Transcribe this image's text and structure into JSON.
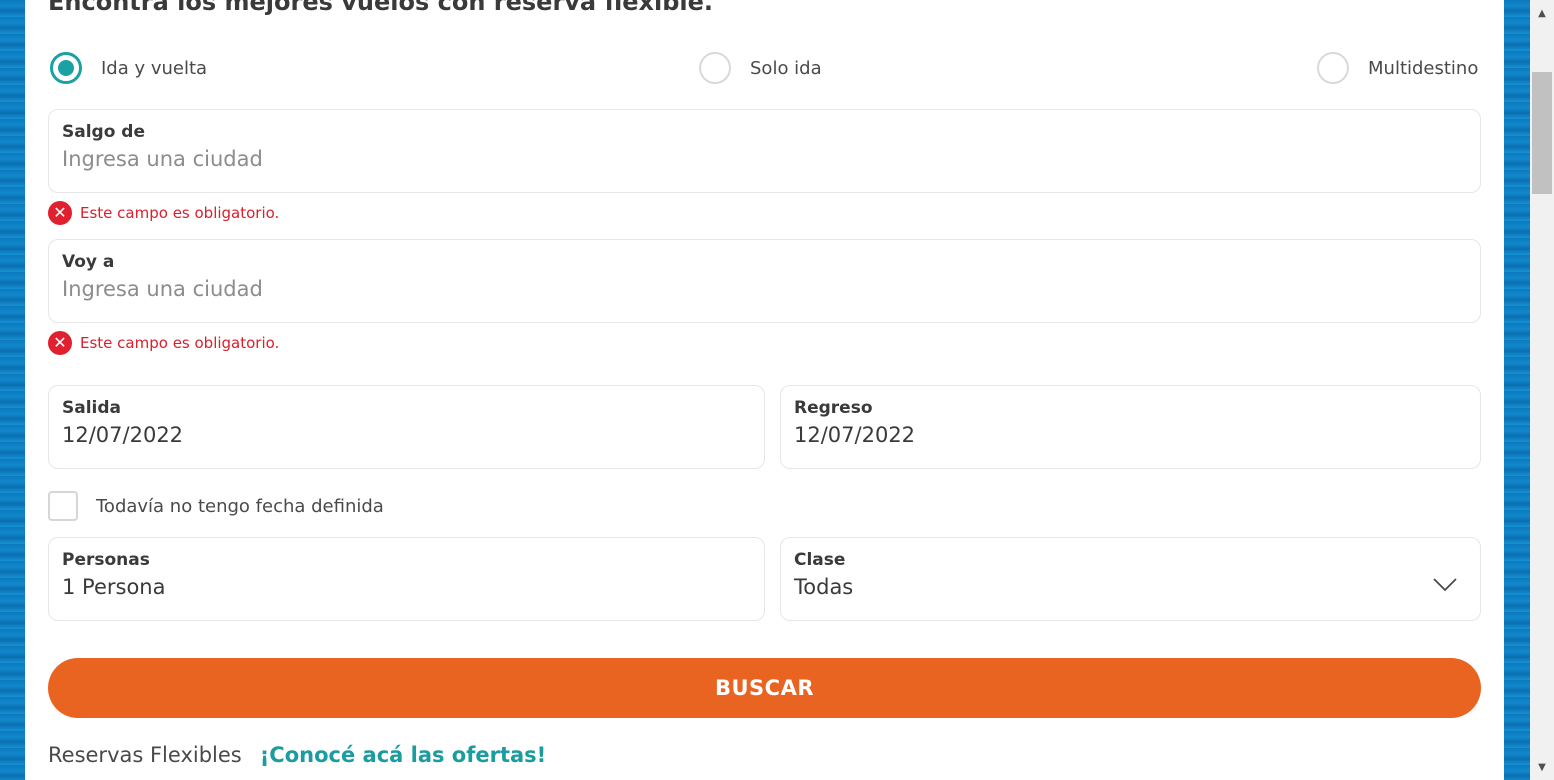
{
  "heading": "Encontrá los mejores vuelos con reserva flexible.",
  "trip_types": [
    {
      "label": "Ida y vuelta",
      "checked": true
    },
    {
      "label": "Solo ida",
      "checked": false
    },
    {
      "label": "Multidestino",
      "checked": false
    }
  ],
  "origin": {
    "label": "Salgo de",
    "placeholder": "Ingresa una ciudad",
    "error": "Este campo es obligatorio."
  },
  "destination": {
    "label": "Voy a",
    "placeholder": "Ingresa una ciudad",
    "error": "Este campo es obligatorio."
  },
  "departure": {
    "label": "Salida",
    "value": "12/07/2022"
  },
  "return": {
    "label": "Regreso",
    "value": "12/07/2022"
  },
  "no_date": {
    "label": "Todavía no tengo fecha definida",
    "checked": false
  },
  "passengers": {
    "label": "Personas",
    "value": "1 Persona"
  },
  "cabin_class": {
    "label": "Clase",
    "value": "Todas"
  },
  "search_button": "BUSCAR",
  "footer": {
    "text": "Reservas Flexibles",
    "link": "¡Conocé acá las ofertas!"
  },
  "colors": {
    "accent": "#1aa1a4",
    "button": "#e96321",
    "error": "#e0202e"
  },
  "icons": {
    "error": "x-circle-icon",
    "dropdown": "chevron-down-icon"
  }
}
